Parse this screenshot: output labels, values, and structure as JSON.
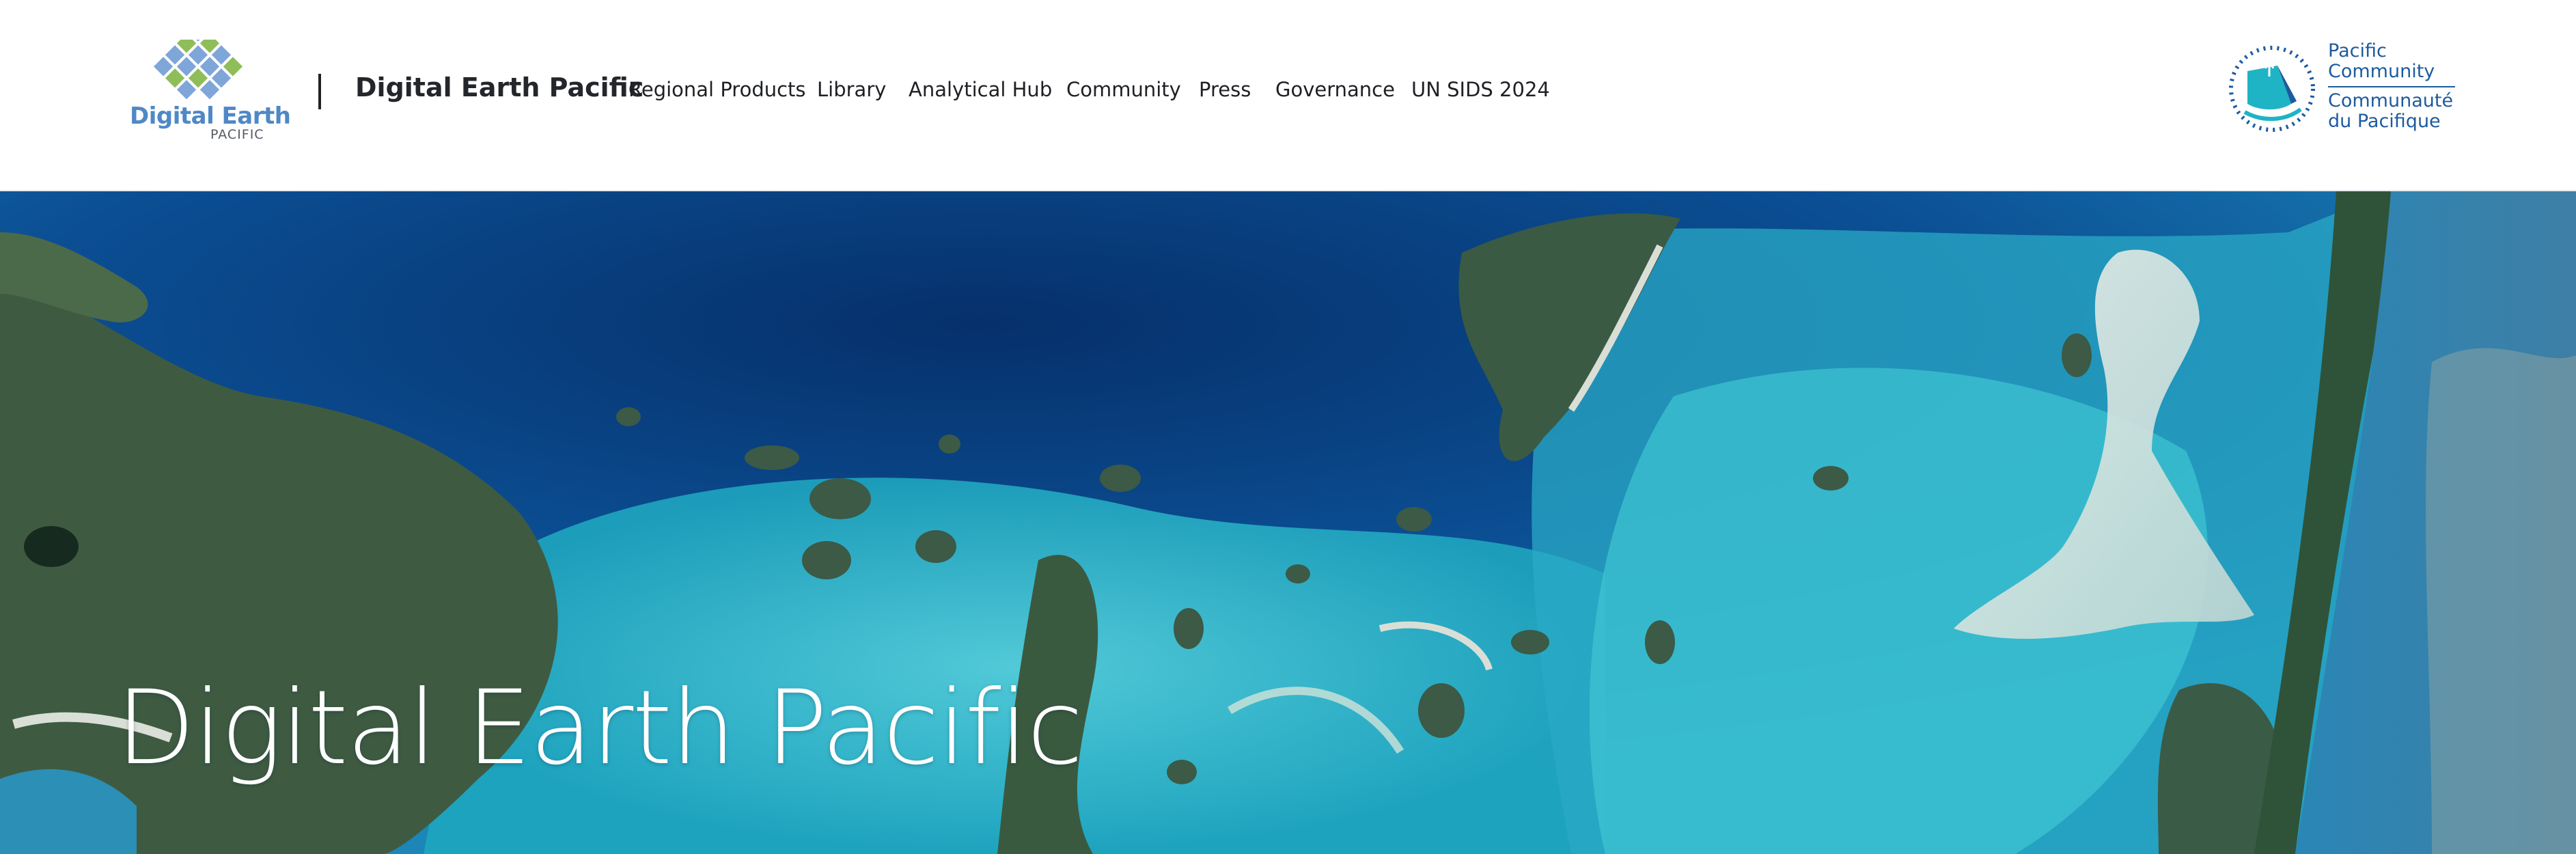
{
  "header": {
    "logo": {
      "word": "Digital Earth",
      "sub": "PACIFIC",
      "colors": {
        "blue": "#7fa6d9",
        "green": "#8fbd5a",
        "text": "#4f88c6"
      }
    },
    "site_title": "Digital Earth Pacific",
    "nav": [
      {
        "label": "Regional Products"
      },
      {
        "label": "Library"
      },
      {
        "label": "Analytical Hub"
      },
      {
        "label": "Community"
      },
      {
        "label": "Press"
      },
      {
        "label": "Governance"
      },
      {
        "label": "UN SIDS 2024"
      }
    ],
    "partner": {
      "lines_en": [
        "Pacific",
        "Community"
      ],
      "lines_fr": [
        "Communauté",
        "du Pacifique"
      ],
      "color": "#1d5b9e",
      "accent": "#1fb3c6"
    }
  },
  "hero": {
    "title": "Digital Earth Pacific",
    "image": "satellite-lagoon-reef-image",
    "colors": {
      "deep": "#073a78",
      "lagoon": "#31b8c8",
      "land": "#3e5b42",
      "sand": "#d9dfd6"
    }
  }
}
